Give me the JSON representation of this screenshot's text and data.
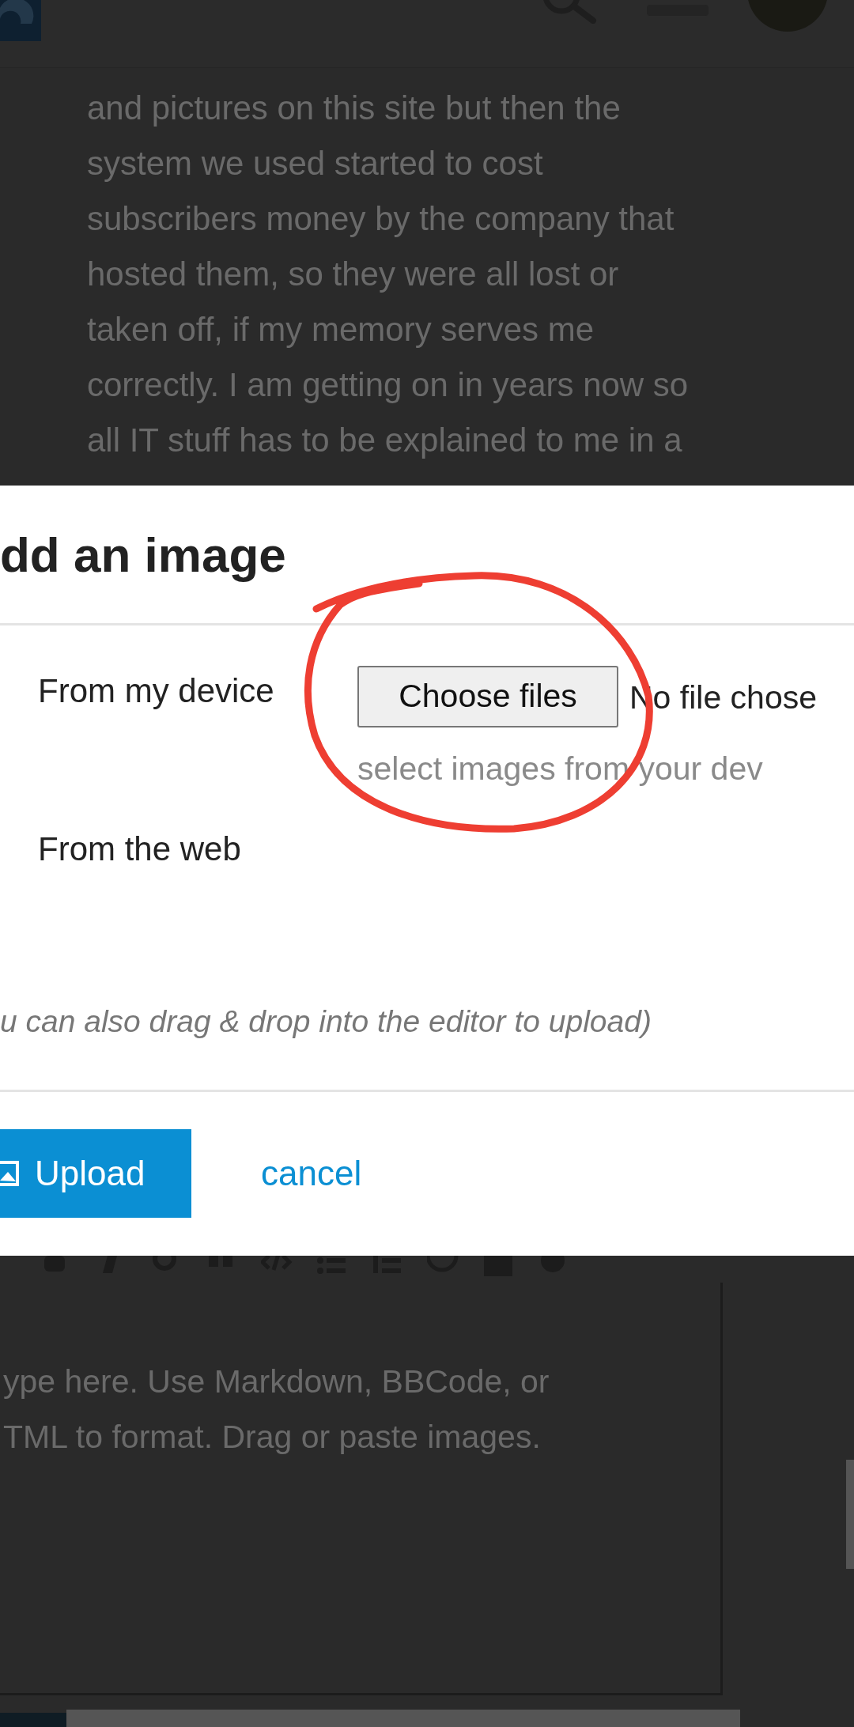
{
  "post_lines": [
    "and pictures on this site but then the",
    "system we used started to cost",
    "subscribers money by the company that",
    "hosted them, so they were all lost or",
    "taken off, if my memory serves me",
    "correctly. I am getting on in years now so",
    "all IT stuff has to be explained to me in a"
  ],
  "dialog": {
    "title": "dd an image",
    "device": {
      "label": "From my device",
      "button": "Choose files",
      "status": "No file chose",
      "hint": "select images from your dev"
    },
    "web": {
      "label": "From the web"
    },
    "note": "u can also drag & drop into the editor to upload)",
    "upload_button": "Upload",
    "cancel_link": "cancel"
  },
  "editor": {
    "placeholder_lines": [
      "ype here. Use Markdown, BBCode, or",
      "TML to format. Drag or paste images."
    ]
  }
}
